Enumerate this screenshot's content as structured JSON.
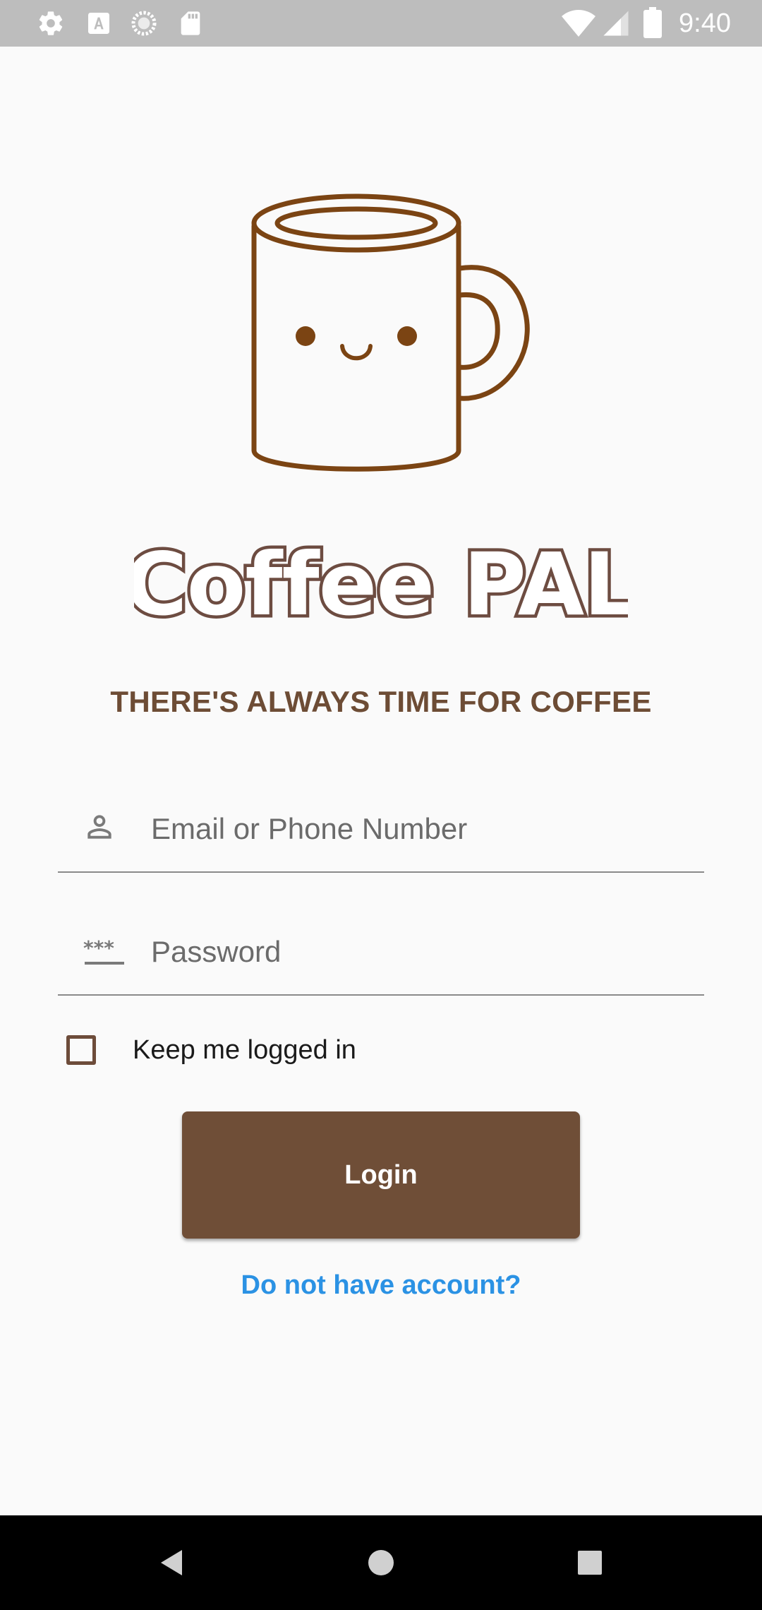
{
  "status_bar": {
    "time": "9:40",
    "left_icons": [
      "gear-icon",
      "font-a-icon",
      "sync-circle-icon",
      "sd-card-icon"
    ],
    "right_icons": [
      "wifi-icon",
      "cell-signal-icon",
      "battery-icon"
    ]
  },
  "logo": {
    "wordmark": "Coffee PAL",
    "mug_color": "#7b4413",
    "wordmark_color": "#6d4c41"
  },
  "tagline": "THERE'S ALWAYS TIME FOR COFFEE",
  "form": {
    "email_placeholder": "Email or Phone Number",
    "email_icon": "person-icon",
    "password_placeholder": "Password",
    "password_icon": "password-icon",
    "keep_logged_in_label": "Keep me logged in",
    "keep_logged_in_checked": false,
    "login_label": "Login",
    "signup_link": "Do not have account?"
  },
  "colors": {
    "brand_brown": "#6f4e37",
    "link_blue": "#2b92e4",
    "background": "#fafafa"
  },
  "nav_bar": {
    "buttons": [
      "back-icon",
      "home-icon",
      "recents-icon"
    ]
  }
}
